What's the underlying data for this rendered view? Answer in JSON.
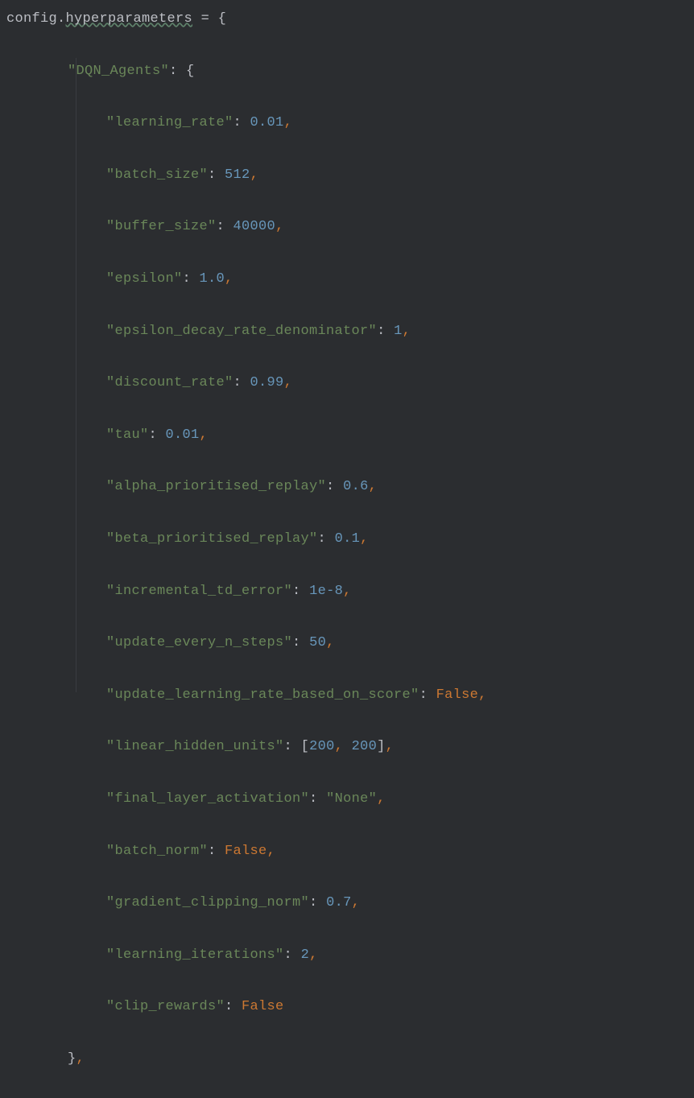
{
  "code": {
    "lhs_obj": "config",
    "lhs_attr": "hyperparameters",
    "assign_op": "=",
    "open_brace": "{",
    "section_key": "\"DQN_Agents\"",
    "section_open": "{",
    "entries": [
      {
        "key": "\"learning_rate\"",
        "value": "0.01",
        "type": "num",
        "trailing_comma": true
      },
      {
        "key": "\"batch_size\"",
        "value": "512",
        "type": "num",
        "trailing_comma": true
      },
      {
        "key": "\"buffer_size\"",
        "value": "40000",
        "type": "num",
        "trailing_comma": true
      },
      {
        "key": "\"epsilon\"",
        "value": "1.0",
        "type": "num",
        "trailing_comma": true
      },
      {
        "key": "\"epsilon_decay_rate_denominator\"",
        "value": "1",
        "type": "num",
        "trailing_comma": true
      },
      {
        "key": "\"discount_rate\"",
        "value": "0.99",
        "type": "num",
        "trailing_comma": true
      },
      {
        "key": "\"tau\"",
        "value": "0.01",
        "type": "num",
        "trailing_comma": true
      },
      {
        "key": "\"alpha_prioritised_replay\"",
        "value": "0.6",
        "type": "num",
        "trailing_comma": true
      },
      {
        "key": "\"beta_prioritised_replay\"",
        "value": "0.1",
        "type": "num",
        "trailing_comma": true
      },
      {
        "key": "\"incremental_td_error\"",
        "value": "1e-8",
        "type": "num",
        "trailing_comma": true
      },
      {
        "key": "\"update_every_n_steps\"",
        "value": "50",
        "type": "num",
        "trailing_comma": true
      },
      {
        "key": "\"update_learning_rate_based_on_score\"",
        "value": "False",
        "type": "kw",
        "trailing_comma": true
      },
      {
        "key": "\"linear_hidden_units\"",
        "value": "[200, 200]",
        "type": "list",
        "list_values": [
          "200",
          "200"
        ],
        "trailing_comma": true
      },
      {
        "key": "\"final_layer_activation\"",
        "value": "\"None\"",
        "type": "str",
        "trailing_comma": true
      },
      {
        "key": "\"batch_norm\"",
        "value": "False",
        "type": "kw",
        "trailing_comma": true
      },
      {
        "key": "\"gradient_clipping_norm\"",
        "value": "0.7",
        "type": "num",
        "trailing_comma": true
      },
      {
        "key": "\"learning_iterations\"",
        "value": "2",
        "type": "num",
        "trailing_comma": true
      },
      {
        "key": "\"clip_rewards\"",
        "value": "False",
        "type": "kw",
        "trailing_comma": false
      }
    ],
    "section_close": "}",
    "section_close_comma": ","
  }
}
